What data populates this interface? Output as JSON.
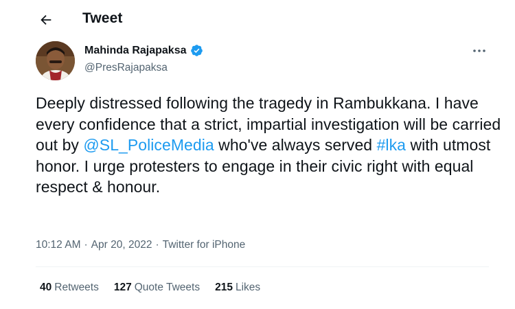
{
  "header": {
    "back_icon": "arrow-left-icon",
    "title": "Tweet"
  },
  "author": {
    "name": "Mahinda Rajapaksa",
    "handle": "@PresRajapaksa",
    "verified": true,
    "verified_color": "#1d9bf0",
    "more_icon": "more-dots-icon"
  },
  "tweet": {
    "segments": [
      {
        "type": "text",
        "text": "Deeply distressed following the tragedy in Rambukkana. I have every confidence that a strict, impartial investigation will be carried out by "
      },
      {
        "type": "mention",
        "text": "@SL_PoliceMedia"
      },
      {
        "type": "text",
        "text": " who've always served "
      },
      {
        "type": "hashtag",
        "text": "#lka"
      },
      {
        "type": "text",
        "text": " with utmost honor. I urge protesters to engage in their civic right with equal respect & honour."
      }
    ],
    "link_color": "#1d9bf0"
  },
  "meta": {
    "time": "10:12 AM",
    "separator": "·",
    "date": "Apr 20, 2022",
    "source": "Twitter for iPhone"
  },
  "stats": {
    "retweets_count": "40",
    "retweets_label": "Retweets",
    "quotes_count": "127",
    "quotes_label": "Quote Tweets",
    "likes_count": "215",
    "likes_label": "Likes"
  }
}
